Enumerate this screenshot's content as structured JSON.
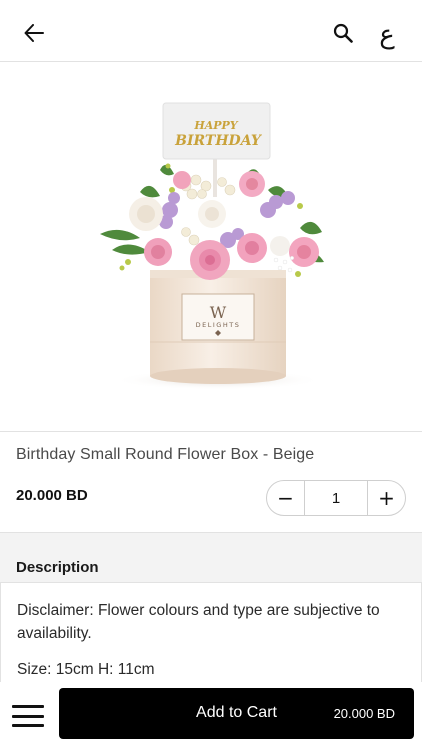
{
  "header": {
    "back_icon": "arrow-left-icon",
    "search_icon": "search-icon",
    "language_toggle": "ع"
  },
  "product": {
    "image_icon": "flower-box-image",
    "topper_text_1": "HAPPY",
    "topper_text_2": "BIRTHDAY",
    "box_logo_letter": "W",
    "box_logo_text": "DELIGHTS",
    "name": "Birthday Small Round Flower Box - Beige",
    "price": "20.000 BD",
    "quantity": "1",
    "qty_minus": "−",
    "qty_plus": "+"
  },
  "description": {
    "title": "Description",
    "disclaimer": "Disclaimer: Flower colours and type are subjective to availability.",
    "size": "Size: 15cm H: 11cm"
  },
  "footer": {
    "menu_icon": "hamburger-menu-icon",
    "cart_label": "Add to Cart",
    "cart_price": "20.000 BD"
  },
  "colors": {
    "accent": "#000000",
    "box": "#f4e8dc",
    "topper_text": "#c9a23a"
  }
}
